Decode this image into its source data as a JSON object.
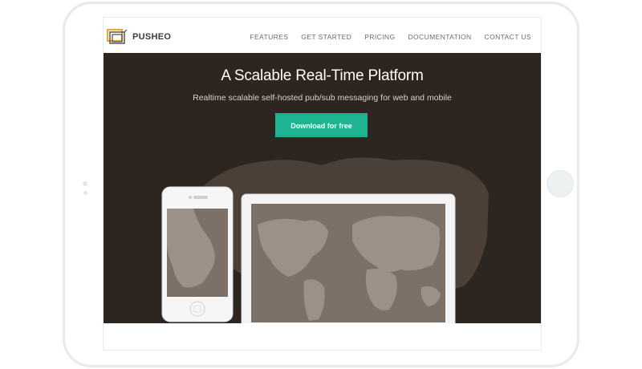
{
  "brand": {
    "name": "PUSHEO",
    "logo_icon": "pusheo-logo-icon",
    "logo_colors": [
      "#f0a92e",
      "#555555"
    ]
  },
  "nav": {
    "items": [
      {
        "label": "FEATURES"
      },
      {
        "label": "GET STARTED"
      },
      {
        "label": "PRICING"
      },
      {
        "label": "DOCUMENTATION"
      },
      {
        "label": "CONTACT US"
      }
    ]
  },
  "hero": {
    "title": "A Scalable Real-Time Platform",
    "subtitle": "Realtime scalable self-hosted pub/sub messaging for web and mobile",
    "cta_label": "Download for free",
    "background_color": "#2d251f",
    "cta_color": "#1fb491"
  },
  "devices": {
    "phone_icon": "smartphone-icon",
    "laptop_icon": "laptop-icon",
    "map_icon": "world-map-icon"
  }
}
